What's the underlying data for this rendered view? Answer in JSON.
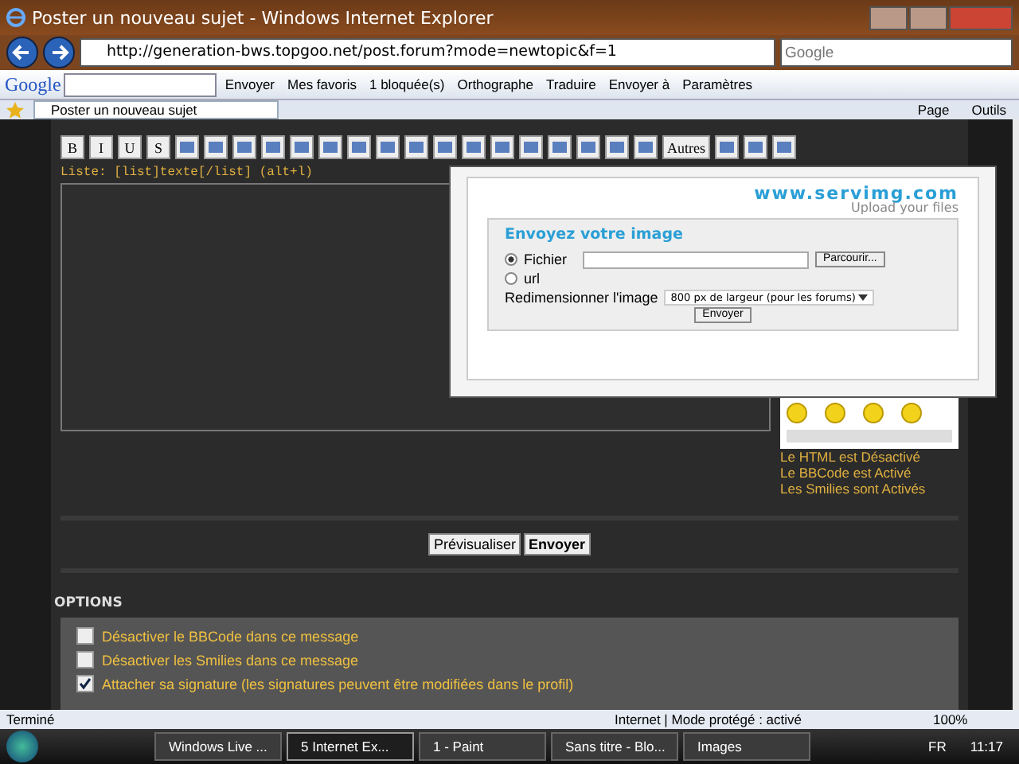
{
  "window": {
    "title": "Poster un nouveau sujet - Windows Internet Explorer"
  },
  "address_bar": {
    "url": "http://generation-bws.topgoo.net/post.forum?mode=newtopic&f=1"
  },
  "search": {
    "placeholder": "Google"
  },
  "google_toolbar": {
    "logo": "Google",
    "items": [
      "Envoyer",
      "Mes favoris",
      "1 bloquée(s)",
      "Orthographe",
      "Traduire",
      "Envoyer à",
      "Paramètres"
    ]
  },
  "tabs": [
    {
      "label": "Poster un nouveau sujet",
      "selected": true
    }
  ],
  "command_bar": [
    "Page",
    "Outils"
  ],
  "editor": {
    "toolbar": [
      {
        "kind": "text",
        "label": "B"
      },
      {
        "kind": "text",
        "label": "I"
      },
      {
        "kind": "text",
        "label": "U"
      },
      {
        "kind": "text",
        "label": "S"
      },
      {
        "kind": "icon"
      },
      {
        "kind": "icon"
      },
      {
        "kind": "icon"
      },
      {
        "kind": "icon"
      },
      {
        "kind": "icon"
      },
      {
        "kind": "icon"
      },
      {
        "kind": "icon"
      },
      {
        "kind": "icon"
      },
      {
        "kind": "icon"
      },
      {
        "kind": "icon"
      },
      {
        "kind": "icon"
      },
      {
        "kind": "icon"
      },
      {
        "kind": "icon"
      },
      {
        "kind": "icon"
      },
      {
        "kind": "icon"
      },
      {
        "kind": "icon"
      },
      {
        "kind": "icon"
      },
      {
        "kind": "text",
        "label": "Autres"
      },
      {
        "kind": "icon"
      },
      {
        "kind": "icon"
      },
      {
        "kind": "icon"
      }
    ],
    "hint": "Liste: [list]texte[/list] (alt+l)"
  },
  "upload": {
    "logo": "www.servimg.com",
    "tagline": "Upload your files",
    "heading": "Envoyez votre image",
    "sources": [
      {
        "label": "Fichier",
        "selected": true
      },
      {
        "label": "url",
        "selected": false
      }
    ],
    "browse_button": "Parcourir...",
    "resize_label": "Redimensionner l'image",
    "resize_value": "800 px de largeur (pour les forums)",
    "submit": "Envoyer"
  },
  "post_status": [
    "Le HTML est Désactivé",
    "Le BBCode est Activé",
    "Les Smilies sont Activés"
  ],
  "buttons": [
    {
      "label": "Prévisualiser",
      "kind": "secondary"
    },
    {
      "label": "Envoyer",
      "kind": "primary"
    }
  ],
  "options": {
    "heading": "OPTIONS",
    "items": [
      {
        "label": "Désactiver le BBCode dans ce message",
        "checked": false
      },
      {
        "label": "Désactiver les Smilies dans ce message",
        "checked": false
      },
      {
        "label": "Attacher sa signature (les signatures peuvent être modifiées dans le profil)",
        "checked": true
      }
    ]
  },
  "status_bar": {
    "text": "Terminé",
    "zone": "Internet | Mode protégé : activé",
    "zoom": "100%"
  },
  "taskbar": {
    "items": [
      {
        "label": "Windows Live ...",
        "selected": false
      },
      {
        "label": "5 Internet Ex...",
        "selected": true
      },
      {
        "label": "1 - Paint",
        "selected": false
      },
      {
        "label": "Sans titre - Blo...",
        "selected": false
      },
      {
        "label": "Images",
        "selected": false
      }
    ],
    "language": "FR",
    "clock": "11:17"
  }
}
